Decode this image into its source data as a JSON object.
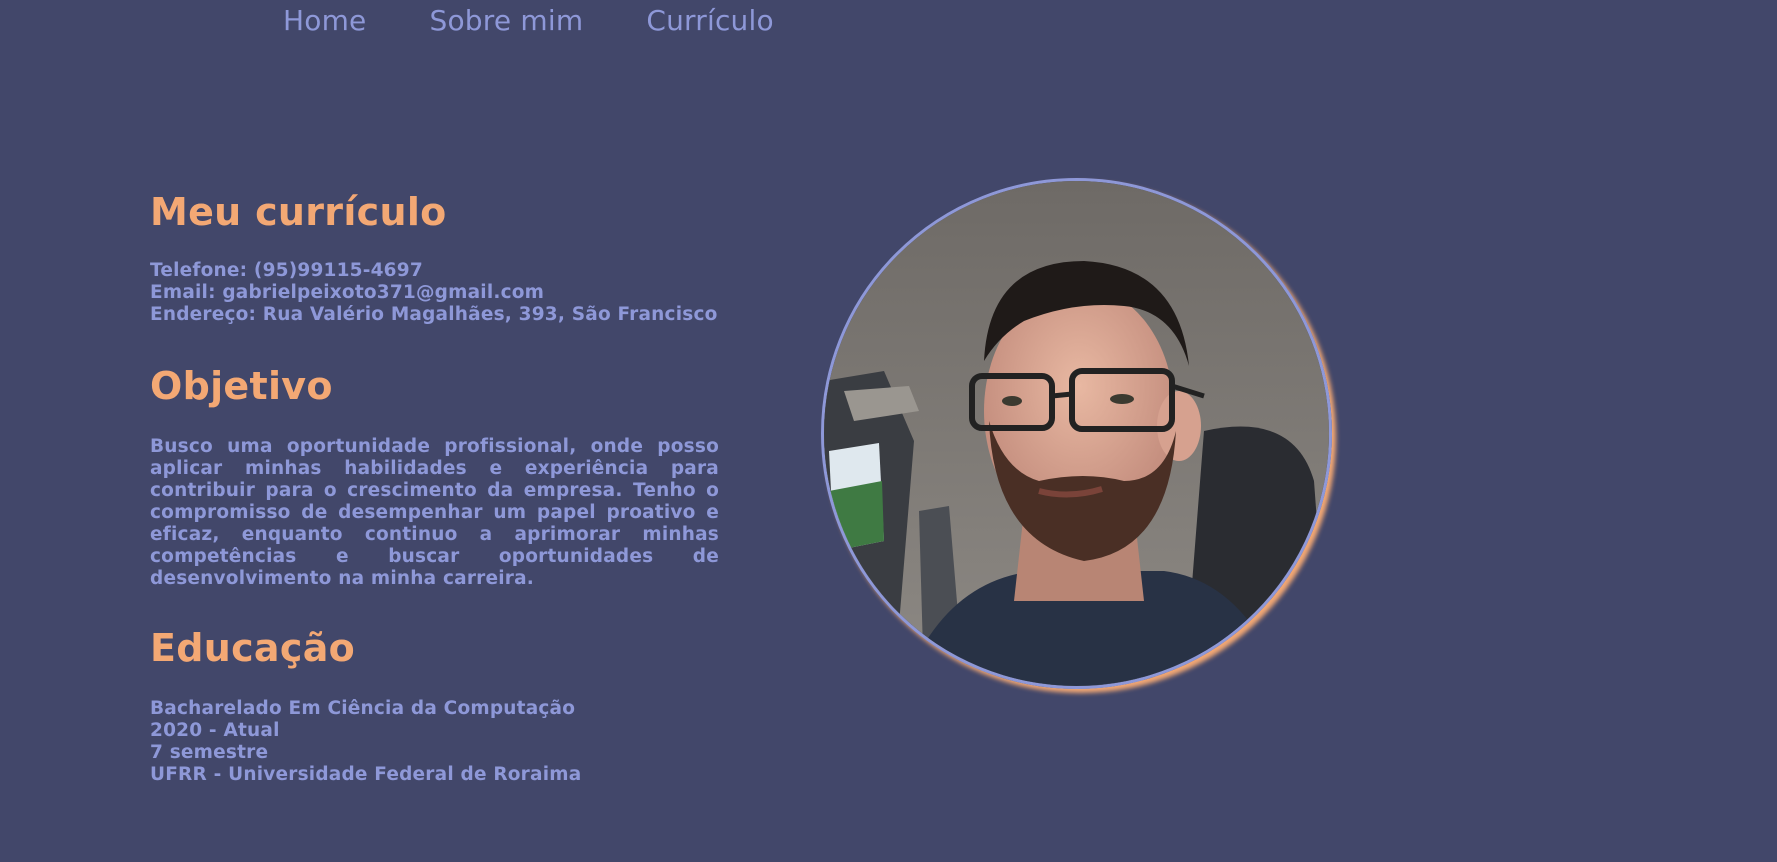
{
  "nav": {
    "items": [
      {
        "label": "Home"
      },
      {
        "label": "Sobre mim"
      },
      {
        "label": "Currículo"
      }
    ]
  },
  "curriculum": {
    "title": "Meu currículo",
    "phone": "Telefone: (95)99115-4697",
    "email": "Email: gabrielpeixoto371@gmail.com",
    "address": "Endereço: Rua Valério Magalhães, 393, São Francisco"
  },
  "objective": {
    "title": "Objetivo",
    "text": "Busco uma oportunidade profissional, onde posso aplicar minhas habilidades e experiência para contribuir para o crescimento da empresa. Tenho o compromisso de desempenhar um papel proativo e eficaz, enquanto continuo a aprimorar minhas competências e buscar oportunidades de desenvolvimento na minha carreira."
  },
  "education": {
    "title": "Educação",
    "degree": "Bacharelado Em Ciência da Computação",
    "period": "2020 - Atual",
    "semester": "7 semestre",
    "institution": "UFRR - Universidade Federal de Roraima"
  },
  "colors": {
    "background": "#42476a",
    "accent": "#f3a874",
    "text": "#8e98d8"
  }
}
